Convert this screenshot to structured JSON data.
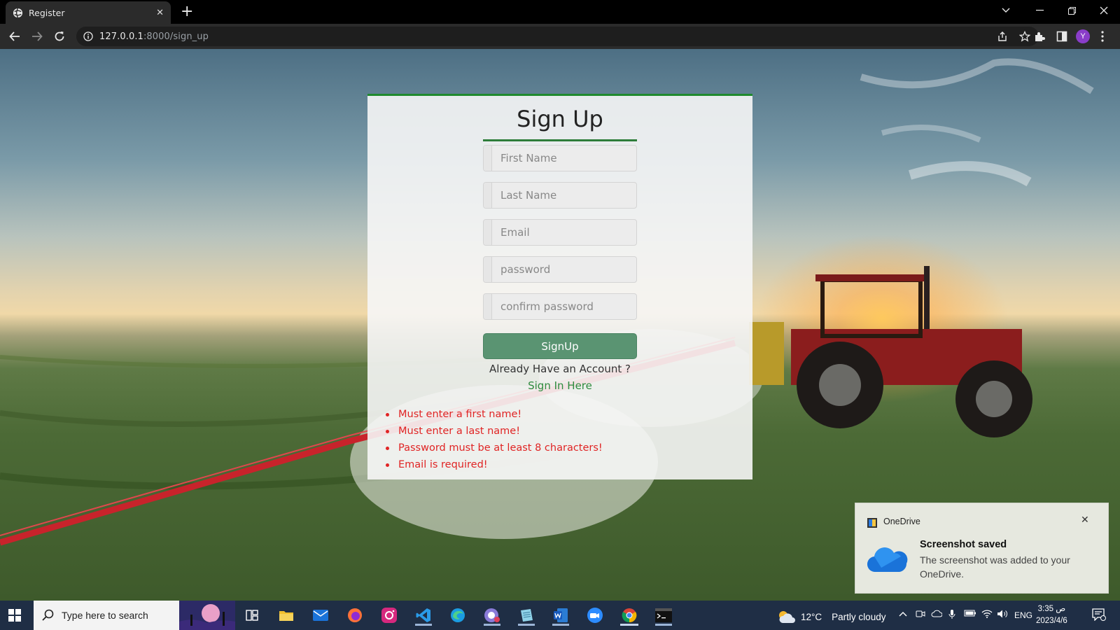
{
  "browser": {
    "tab_title": "Register",
    "url_host": "127.0.0.1",
    "url_rest": ":8000/sign_up",
    "profile_initial": "Y"
  },
  "form": {
    "title": "Sign Up",
    "fields": [
      {
        "name": "first-name-input",
        "placeholder": "First Name"
      },
      {
        "name": "last-name-input",
        "placeholder": "Last Name"
      },
      {
        "name": "email-input",
        "placeholder": "Email"
      },
      {
        "name": "password-input",
        "placeholder": "password"
      },
      {
        "name": "confirm-password-input",
        "placeholder": "confirm password"
      }
    ],
    "submit_label": "SignUp",
    "account_prompt": "Already Have an Account ?",
    "signin_link": "Sign In Here",
    "errors": [
      "Must enter a first name!",
      "Must enter a last name!",
      "Password must be at least 8 characters!",
      "Email is required!"
    ]
  },
  "toast": {
    "app": "OneDrive",
    "title": "Screenshot saved",
    "body": "The screenshot was added to your OneDrive."
  },
  "taskbar": {
    "search_placeholder": "Type here to search",
    "weather_temp": "12°C",
    "weather_desc": "Partly cloudy",
    "language": "ENG",
    "time": "3:35 ص",
    "date": "2023/4/6"
  },
  "colors": {
    "accent_green": "#2e7d3a",
    "button_green": "#5a9472",
    "error_red": "#e02424"
  }
}
